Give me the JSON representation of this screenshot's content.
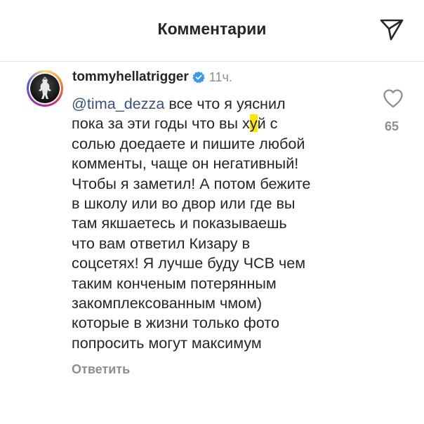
{
  "header": {
    "title": "Комментарии"
  },
  "comment": {
    "username": "tommyhellatrigger",
    "time": "11ч.",
    "mention": "@tima_dezza",
    "lines": [
      "все что я уяснил",
      "пока за эти годы что вы х",
      "й с",
      "солью доедаете и пишите любой",
      "комменты, чаще он негативный!",
      "Чтобы я заметил! А потом бежите",
      "в школу или во двор или где вы",
      "там якшаетесь и показываешь",
      "что вам ответил Кизару в",
      "соцсетях! Я лучше буду ЧСВ чем",
      "таким конченым потерянным",
      "закомплексованным чмом)",
      "которые в жизни только фото",
      "попросить могут максимум"
    ],
    "censored_char": "у",
    "reply_label": "Ответить",
    "like_count": "65"
  },
  "colors": {
    "text": "#262626",
    "secondary": "#8e8e8e",
    "mention": "#385185",
    "verified": "#3897f0",
    "highlight": "#ffe600"
  },
  "icons": {
    "share": "paper-plane-icon",
    "like": "heart-outline-icon",
    "verified": "verified-badge-icon"
  }
}
